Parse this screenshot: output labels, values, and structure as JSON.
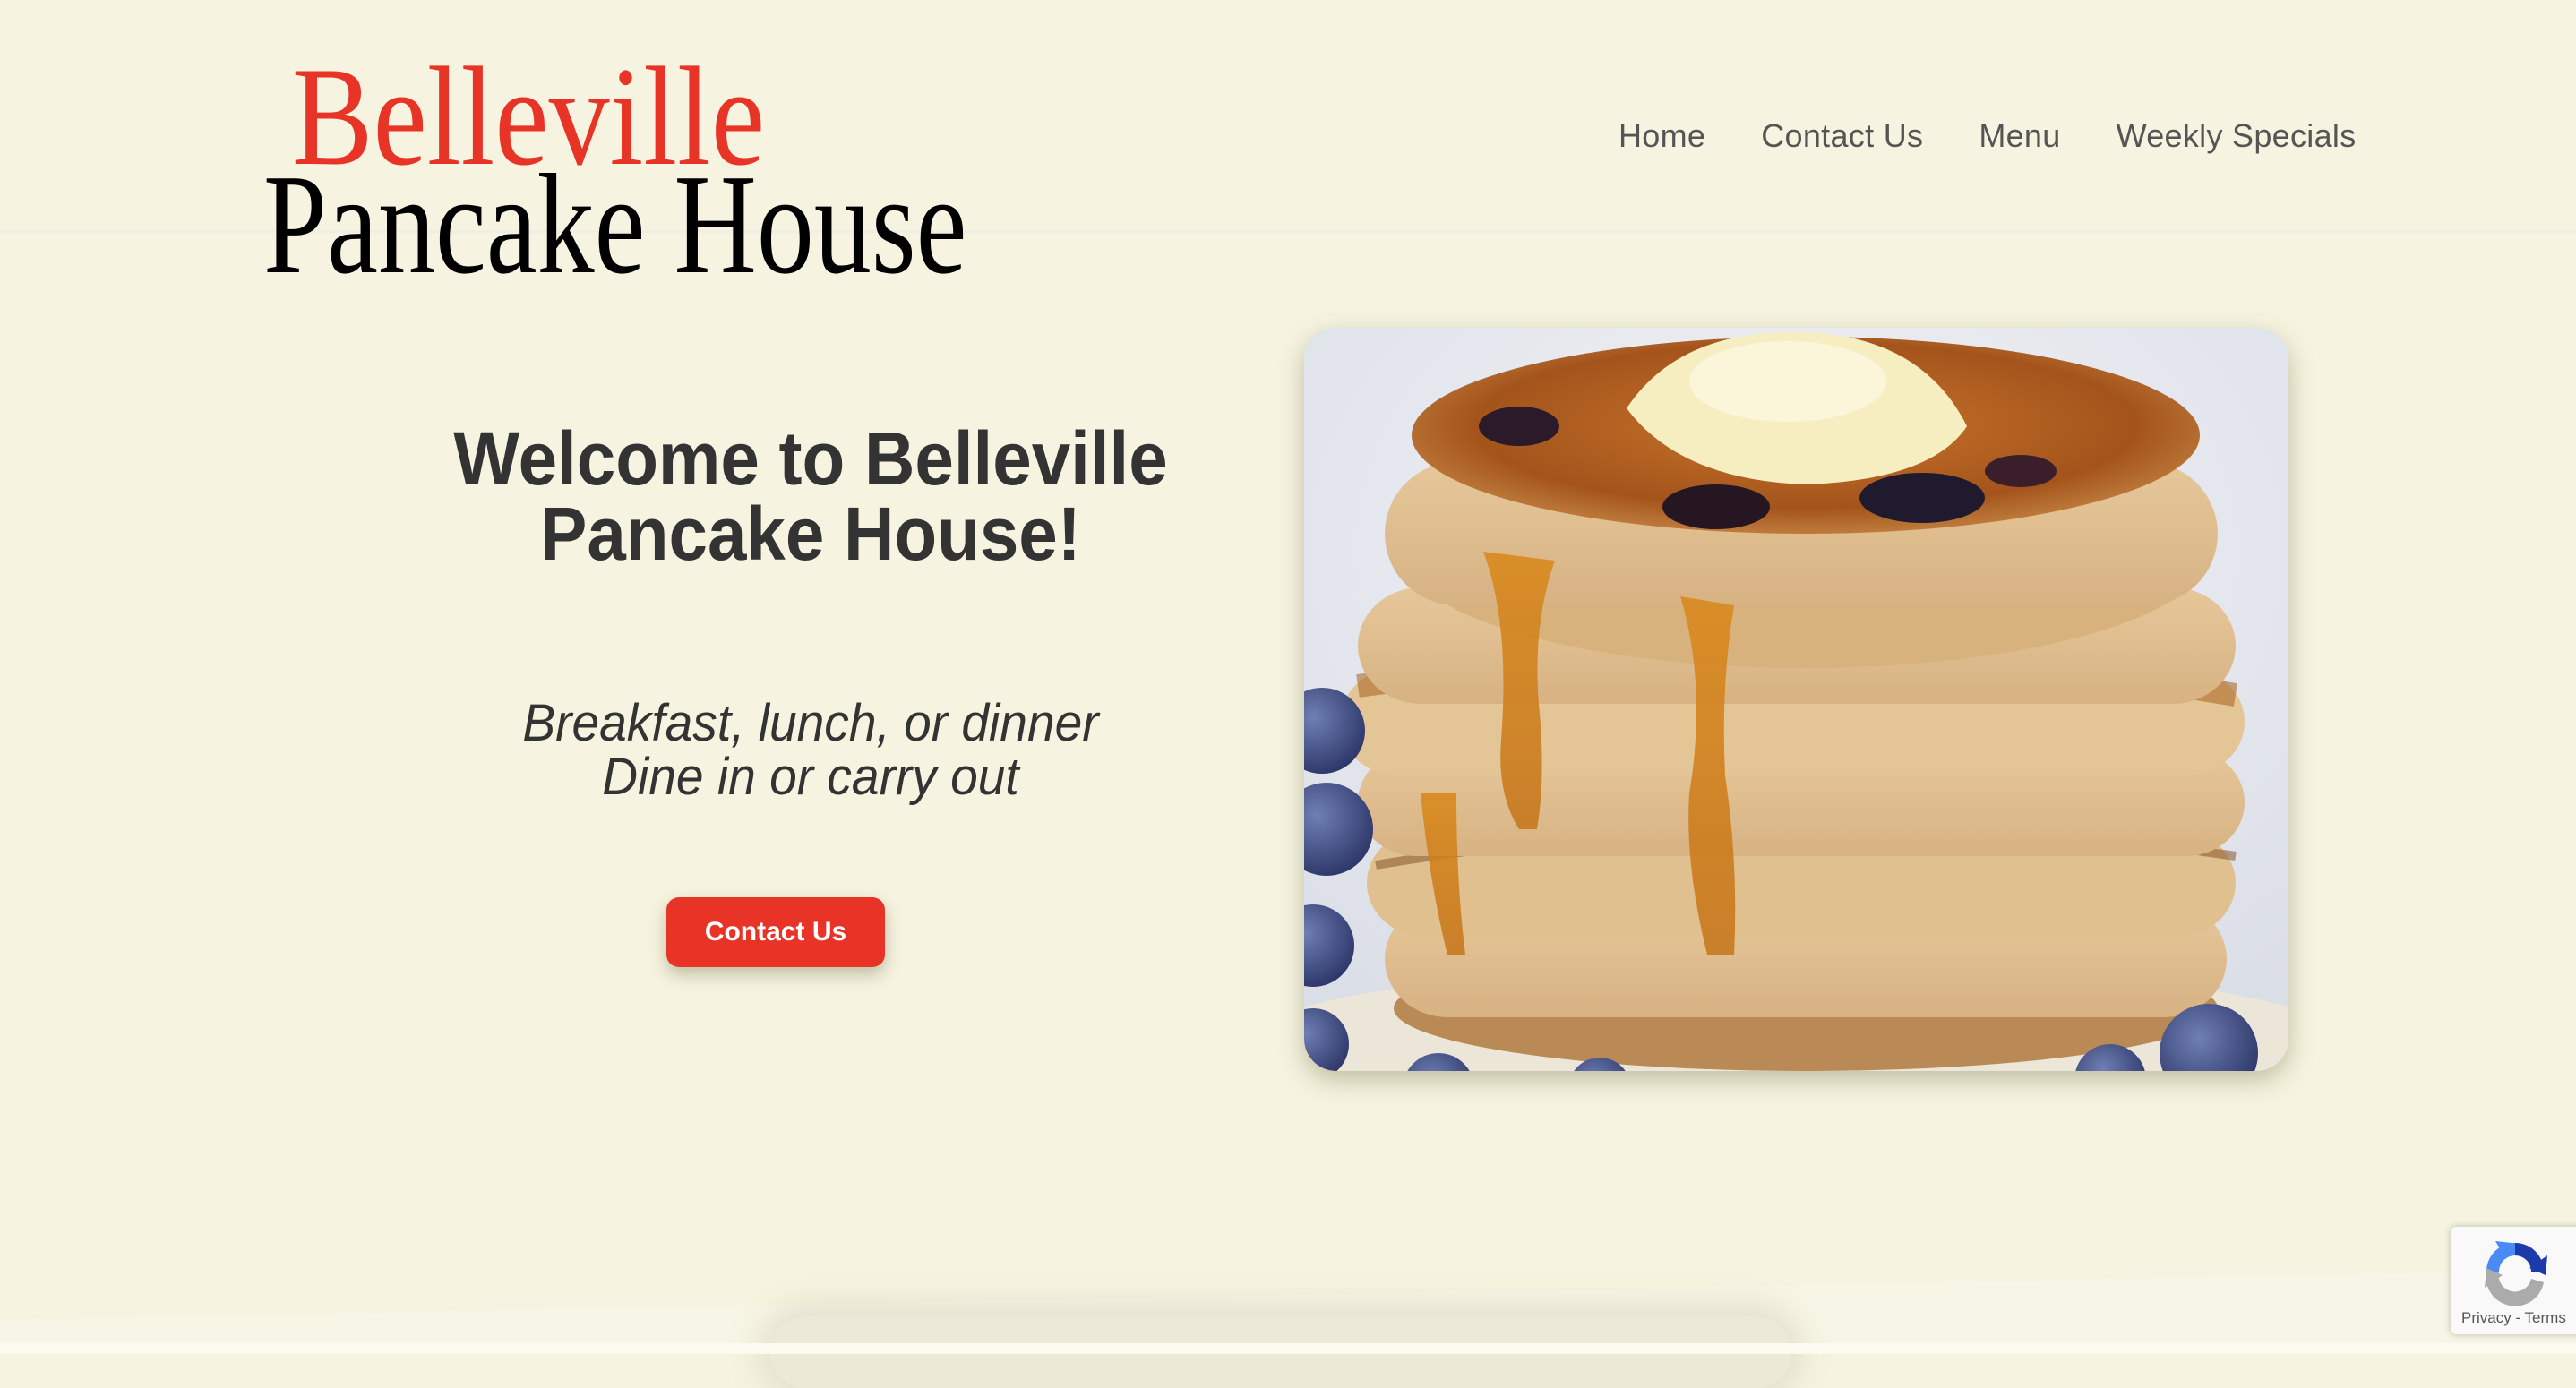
{
  "site": {
    "logo_line1": "Belleville",
    "logo_line2": "Pancake House",
    "brand_color": "#E83426"
  },
  "nav": {
    "items": [
      {
        "label": "Home"
      },
      {
        "label": "Contact Us"
      },
      {
        "label": "Menu"
      },
      {
        "label": "Weekly Specials"
      }
    ]
  },
  "hero": {
    "title_line1": "Welcome to Belleville",
    "title_line2": "Pancake House!",
    "subtitle_line1": "Breakfast, lunch, or dinner",
    "subtitle_line2": "Dine in or carry out",
    "cta_label": "Contact Us",
    "image_alt": "Stack of blueberry pancakes with butter and syrup"
  },
  "recaptcha": {
    "privacy_label": "Privacy",
    "separator": " - ",
    "terms_label": "Terms"
  }
}
